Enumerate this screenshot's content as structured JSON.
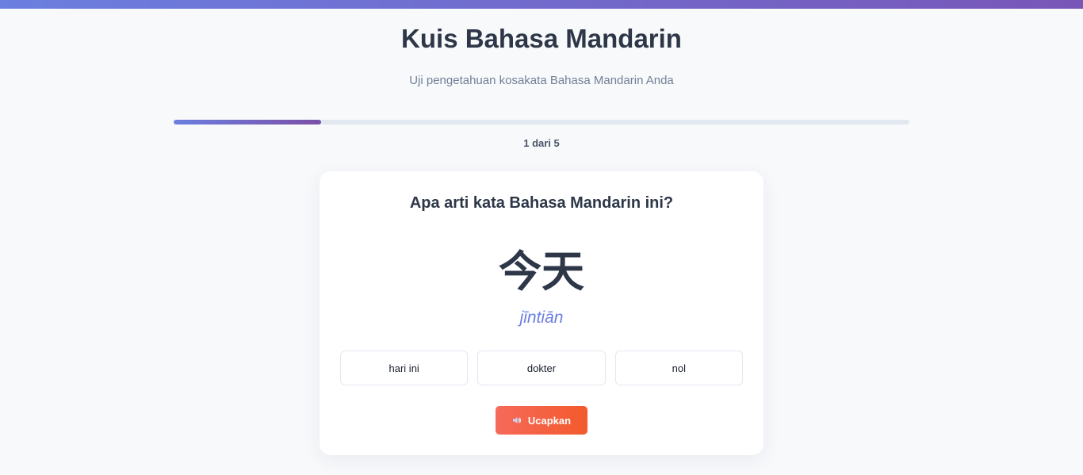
{
  "header": {
    "title": "Kuis Bahasa Mandarin",
    "subtitle": "Uji pengetahuan kosakata Bahasa Mandarin Anda"
  },
  "progress": {
    "text": "1 dari 5",
    "current": 1,
    "total": 5,
    "fraction": 0.2
  },
  "card": {
    "question": "Apa arti kata Bahasa Mandarin ini?",
    "hanzi": "今天",
    "pinyin": "jīntiān",
    "options": [
      "hari ini",
      "dokter",
      "nol"
    ],
    "speak_label": "Ucapkan",
    "speak_icon": "speaker-icon"
  },
  "colors": {
    "accent": "#6b7fe0",
    "accent_end": "#7b4fa6",
    "button_start": "#f66a5a",
    "button_end": "#f35a2c",
    "text_dark": "#2d3748"
  }
}
